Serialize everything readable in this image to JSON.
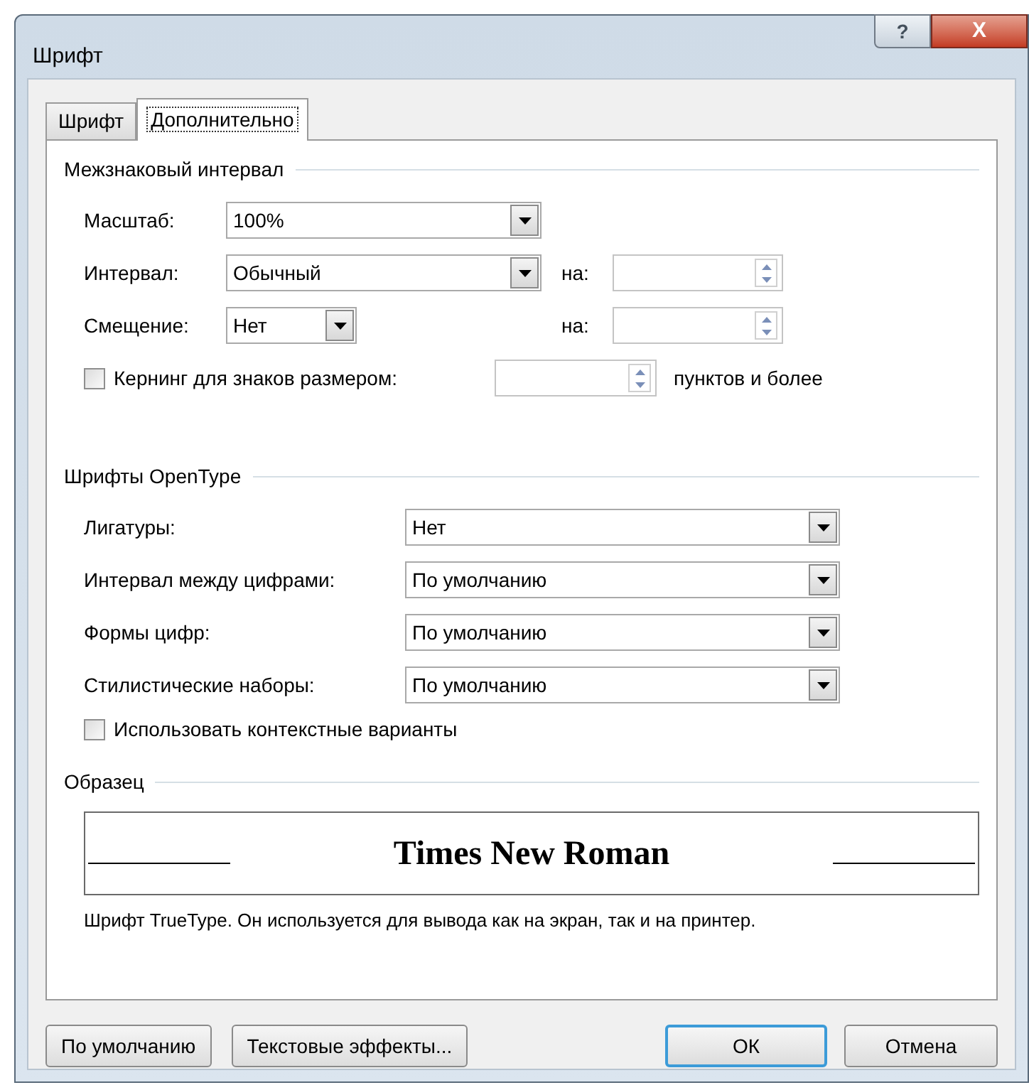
{
  "window": {
    "title": "Шрифт",
    "help_button": "?",
    "close_button": "X"
  },
  "tabs": [
    {
      "label": "Шрифт",
      "selected": false
    },
    {
      "label": "Дополнительно",
      "selected": true
    }
  ],
  "spacing": {
    "heading": "Межзнаковый интервал",
    "scale": {
      "label": "Масштаб:",
      "value": "100%"
    },
    "interval": {
      "label": "Интервал:",
      "value": "Обычный",
      "by_label": "на:"
    },
    "position": {
      "label": "Смещение:",
      "value": "Нет",
      "by_label": "на:"
    },
    "kerning": {
      "label": "Кернинг для знаков размером:",
      "checked": false,
      "suffix": "пунктов и более"
    }
  },
  "opentype": {
    "heading": "Шрифты OpenType",
    "rows": [
      {
        "label": "Лигатуры:",
        "value": "Нет"
      },
      {
        "label": "Интервал между цифрами:",
        "value": "По умолчанию"
      },
      {
        "label": "Формы цифр:",
        "value": "По умолчанию"
      },
      {
        "label": "Стилистические наборы:",
        "value": "По умолчанию"
      }
    ],
    "contextual": {
      "label": "Использовать контекстные варианты",
      "checked": false
    }
  },
  "preview": {
    "heading": "Образец",
    "sample": "Times New Roman",
    "description": "Шрифт TrueType. Он используется для вывода как на экран, так и на принтер."
  },
  "buttons": [
    {
      "label": "По умолчанию",
      "kind": "secondary"
    },
    {
      "label": "Текстовые эффекты...",
      "kind": "secondary"
    },
    {
      "label": "ОК",
      "kind": "default"
    },
    {
      "label": "Отмена",
      "kind": "secondary"
    }
  ]
}
